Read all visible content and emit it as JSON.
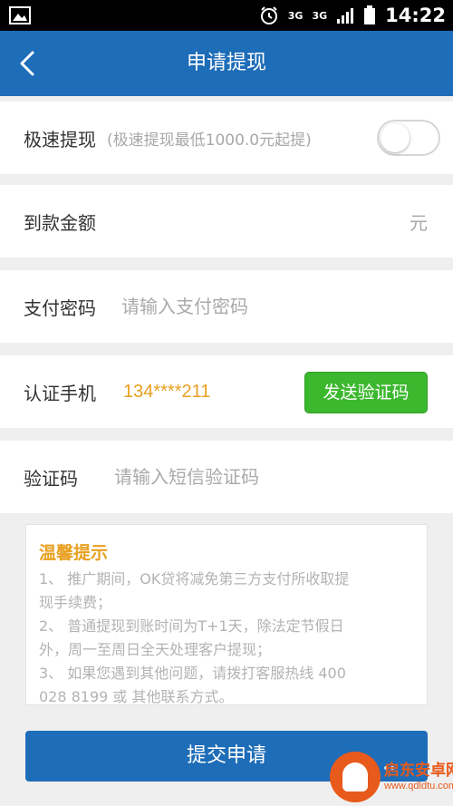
{
  "status_bar": {
    "network_1": "3G",
    "network_2": "3G",
    "time": "14:22"
  },
  "header": {
    "title": "申请提现"
  },
  "express": {
    "label": "极速提现",
    "hint": "(极速提现最低1000.0元起提)",
    "toggle_on": false
  },
  "amount": {
    "label": "到款金额",
    "value": "",
    "unit": "元"
  },
  "password": {
    "label": "支付密码",
    "placeholder": "请输入支付密码"
  },
  "phone": {
    "label": "认证手机",
    "value": "134****211",
    "send_label": "发送验证码"
  },
  "code": {
    "label": "验证码",
    "placeholder": "请输入短信验证码"
  },
  "tips": {
    "title": "温馨提示",
    "lines": [
      "1、 推广期间，OK贷将减免第三方支付所收取提",
      "现手续费；",
      "2、 普通提现到账时间为T+1天，除法定节假日",
      "外，周一至周日全天处理客户提现；",
      "3、 如果您遇到其他问题，请拨打客服热线 400",
      "028 8199 或 其他联系方式。"
    ]
  },
  "submit_label": "提交申请",
  "watermark": {
    "text": "启东安卓网",
    "url": "www.qdldtu.com"
  },
  "colors": {
    "primary": "#1e6db8",
    "accent_orange": "#e8a020",
    "send_green": "#3cb82e"
  }
}
